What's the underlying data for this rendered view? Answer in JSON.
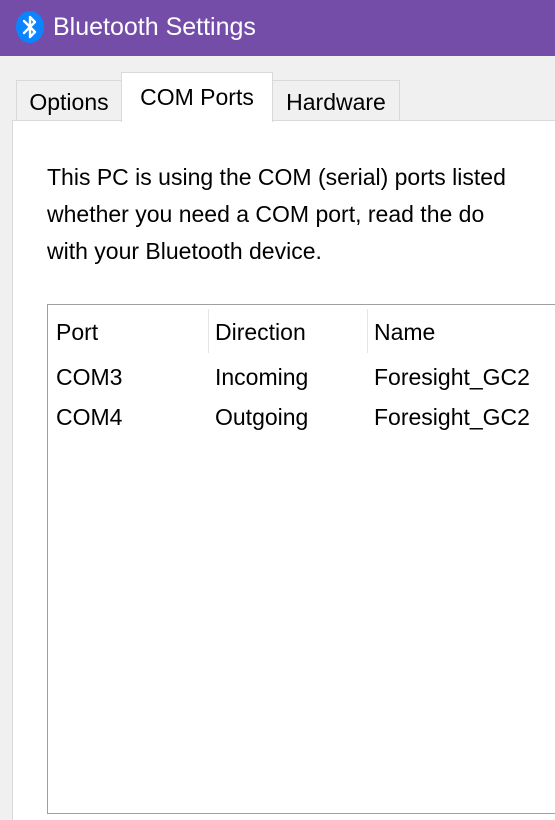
{
  "window": {
    "title": "Bluetooth Settings",
    "icon": "bluetooth-icon",
    "accent_color": "#744da9"
  },
  "tabs": [
    {
      "label": "Options",
      "selected": false
    },
    {
      "label": "COM Ports",
      "selected": true
    },
    {
      "label": "Hardware",
      "selected": false
    }
  ],
  "description": {
    "line1": "This PC is using the COM (serial) ports listed",
    "line2": "whether you need a COM port, read the do",
    "line3": "with your Bluetooth device."
  },
  "ports_table": {
    "columns": [
      "Port",
      "Direction",
      "Name"
    ],
    "rows": [
      {
        "port": "COM3",
        "direction": "Incoming",
        "name": "Foresight_GC2"
      },
      {
        "port": "COM4",
        "direction": "Outgoing",
        "name": "Foresight_GC2"
      }
    ]
  }
}
